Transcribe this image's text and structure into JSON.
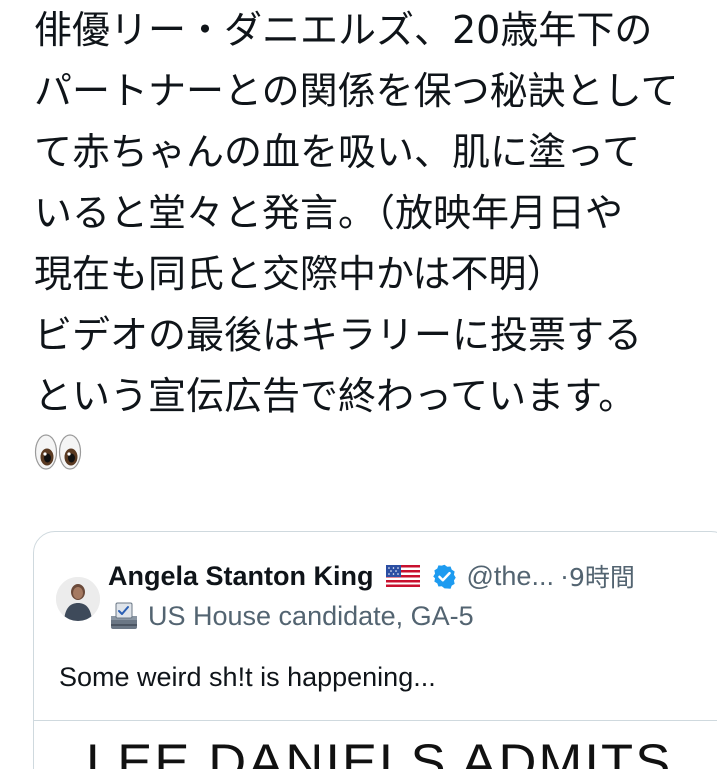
{
  "tweet": {
    "lines": [
      "俳優リー・ダニエルズ、20歳年下の",
      "パートナーとの関係を保つ秘訣として",
      "て赤ちゃんの血を吸い、肌に塗って",
      "いると堂々と発言。（放映年月日や",
      "現在も同氏と交際中かは不明）",
      "ビデオの最後はキラリーに投票する",
      "という宣伝広告で終わっています。"
    ],
    "emoji": "eyes-emoji"
  },
  "quoted_tweet": {
    "author_name": "Angela Stanton King",
    "flag_icon": "us-flag-icon",
    "verified_icon": "verified-badge-icon",
    "handle": "@the...",
    "separator": "·",
    "time_ago": "9時間",
    "bio_icon": "ballot-box-icon",
    "bio": "US House candidate, GA-5",
    "text": "Some weird sh!t is happening...",
    "media_headline": "LEE DANIELS ADMITS"
  },
  "colors": {
    "text": "#0f1419",
    "muted": "#536471",
    "border": "#cfd9de",
    "verified": "#1d9bf0"
  }
}
